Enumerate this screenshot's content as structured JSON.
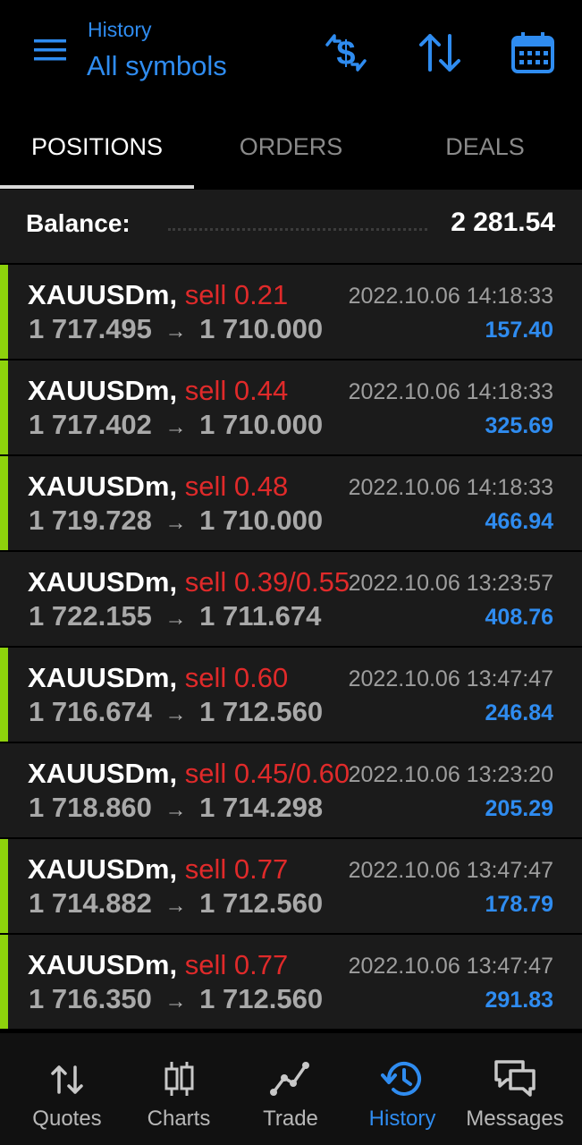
{
  "header": {
    "subtitle": "History",
    "title": "All symbols",
    "accent_color": "#2f8cf0",
    "actions": [
      "dollar-exchange-icon",
      "sort-icon",
      "calendar-icon"
    ]
  },
  "tabs": [
    {
      "label": "POSITIONS",
      "active": true
    },
    {
      "label": "ORDERS",
      "active": false
    },
    {
      "label": "DEALS",
      "active": false
    }
  ],
  "balance": {
    "label": "Balance:",
    "value": "2 281.54"
  },
  "positions": [
    {
      "symbol": "XAUUSDm,",
      "side": "sell 0.21",
      "open_price": "1 717.495",
      "close_price": "1 710.000",
      "time": "2022.10.06 14:18:33",
      "profit": "157.40",
      "marked": true
    },
    {
      "symbol": "XAUUSDm,",
      "side": "sell 0.44",
      "open_price": "1 717.402",
      "close_price": "1 710.000",
      "time": "2022.10.06 14:18:33",
      "profit": "325.69",
      "marked": true
    },
    {
      "symbol": "XAUUSDm,",
      "side": "sell 0.48",
      "open_price": "1 719.728",
      "close_price": "1 710.000",
      "time": "2022.10.06 14:18:33",
      "profit": "466.94",
      "marked": true
    },
    {
      "symbol": "XAUUSDm,",
      "side": "sell 0.39/0.55",
      "open_price": "1 722.155",
      "close_price": "1 711.674",
      "time": "2022.10.06 13:23:57",
      "profit": "408.76",
      "marked": false
    },
    {
      "symbol": "XAUUSDm,",
      "side": "sell 0.60",
      "open_price": "1 716.674",
      "close_price": "1 712.560",
      "time": "2022.10.06 13:47:47",
      "profit": "246.84",
      "marked": true
    },
    {
      "symbol": "XAUUSDm,",
      "side": "sell 0.45/0.60",
      "open_price": "1 718.860",
      "close_price": "1 714.298",
      "time": "2022.10.06 13:23:20",
      "profit": "205.29",
      "marked": false
    },
    {
      "symbol": "XAUUSDm,",
      "side": "sell 0.77",
      "open_price": "1 714.882",
      "close_price": "1 712.560",
      "time": "2022.10.06 13:47:47",
      "profit": "178.79",
      "marked": true
    },
    {
      "symbol": "XAUUSDm,",
      "side": "sell 0.77",
      "open_price": "1 716.350",
      "close_price": "1 712.560",
      "time": "2022.10.06 13:47:47",
      "profit": "291.83",
      "marked": true
    }
  ],
  "row_arrow": "→",
  "colors": {
    "sell": "#e02a2a",
    "profit": "#2f8cf0",
    "marker": "#8ed20c"
  },
  "bottom_nav": [
    {
      "label": "Quotes",
      "icon": "quotes-icon",
      "active": false
    },
    {
      "label": "Charts",
      "icon": "charts-icon",
      "active": false
    },
    {
      "label": "Trade",
      "icon": "trade-icon",
      "active": false
    },
    {
      "label": "History",
      "icon": "history-icon",
      "active": true
    },
    {
      "label": "Messages",
      "icon": "messages-icon",
      "active": false
    }
  ]
}
